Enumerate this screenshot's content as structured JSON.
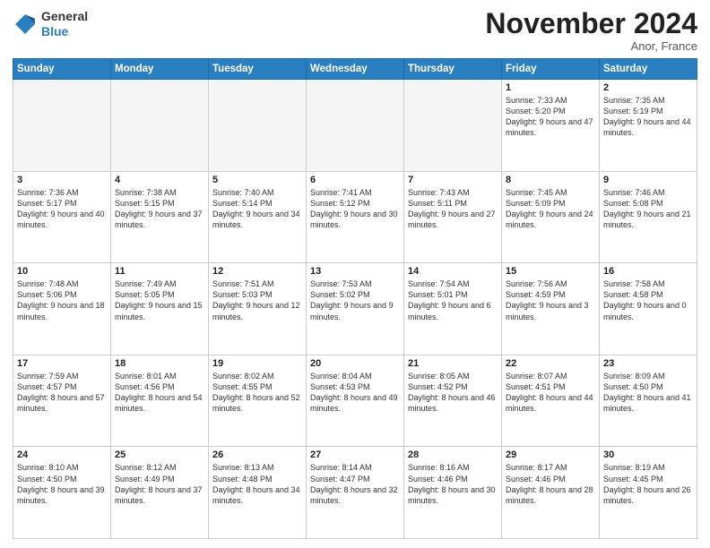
{
  "header": {
    "logo_line1": "General",
    "logo_line2": "Blue",
    "month_title": "November 2024",
    "location": "Anor, France"
  },
  "weekdays": [
    "Sunday",
    "Monday",
    "Tuesday",
    "Wednesday",
    "Thursday",
    "Friday",
    "Saturday"
  ],
  "weeks": [
    [
      {
        "day": "",
        "info": ""
      },
      {
        "day": "",
        "info": ""
      },
      {
        "day": "",
        "info": ""
      },
      {
        "day": "",
        "info": ""
      },
      {
        "day": "",
        "info": ""
      },
      {
        "day": "1",
        "info": "Sunrise: 7:33 AM\nSunset: 5:20 PM\nDaylight: 9 hours and 47 minutes."
      },
      {
        "day": "2",
        "info": "Sunrise: 7:35 AM\nSunset: 5:19 PM\nDaylight: 9 hours and 44 minutes."
      }
    ],
    [
      {
        "day": "3",
        "info": "Sunrise: 7:36 AM\nSunset: 5:17 PM\nDaylight: 9 hours and 40 minutes."
      },
      {
        "day": "4",
        "info": "Sunrise: 7:38 AM\nSunset: 5:15 PM\nDaylight: 9 hours and 37 minutes."
      },
      {
        "day": "5",
        "info": "Sunrise: 7:40 AM\nSunset: 5:14 PM\nDaylight: 9 hours and 34 minutes."
      },
      {
        "day": "6",
        "info": "Sunrise: 7:41 AM\nSunset: 5:12 PM\nDaylight: 9 hours and 30 minutes."
      },
      {
        "day": "7",
        "info": "Sunrise: 7:43 AM\nSunset: 5:11 PM\nDaylight: 9 hours and 27 minutes."
      },
      {
        "day": "8",
        "info": "Sunrise: 7:45 AM\nSunset: 5:09 PM\nDaylight: 9 hours and 24 minutes."
      },
      {
        "day": "9",
        "info": "Sunrise: 7:46 AM\nSunset: 5:08 PM\nDaylight: 9 hours and 21 minutes."
      }
    ],
    [
      {
        "day": "10",
        "info": "Sunrise: 7:48 AM\nSunset: 5:06 PM\nDaylight: 9 hours and 18 minutes."
      },
      {
        "day": "11",
        "info": "Sunrise: 7:49 AM\nSunset: 5:05 PM\nDaylight: 9 hours and 15 minutes."
      },
      {
        "day": "12",
        "info": "Sunrise: 7:51 AM\nSunset: 5:03 PM\nDaylight: 9 hours and 12 minutes."
      },
      {
        "day": "13",
        "info": "Sunrise: 7:53 AM\nSunset: 5:02 PM\nDaylight: 9 hours and 9 minutes."
      },
      {
        "day": "14",
        "info": "Sunrise: 7:54 AM\nSunset: 5:01 PM\nDaylight: 9 hours and 6 minutes."
      },
      {
        "day": "15",
        "info": "Sunrise: 7:56 AM\nSunset: 4:59 PM\nDaylight: 9 hours and 3 minutes."
      },
      {
        "day": "16",
        "info": "Sunrise: 7:58 AM\nSunset: 4:58 PM\nDaylight: 9 hours and 0 minutes."
      }
    ],
    [
      {
        "day": "17",
        "info": "Sunrise: 7:59 AM\nSunset: 4:57 PM\nDaylight: 8 hours and 57 minutes."
      },
      {
        "day": "18",
        "info": "Sunrise: 8:01 AM\nSunset: 4:56 PM\nDaylight: 8 hours and 54 minutes."
      },
      {
        "day": "19",
        "info": "Sunrise: 8:02 AM\nSunset: 4:55 PM\nDaylight: 8 hours and 52 minutes."
      },
      {
        "day": "20",
        "info": "Sunrise: 8:04 AM\nSunset: 4:53 PM\nDaylight: 8 hours and 49 minutes."
      },
      {
        "day": "21",
        "info": "Sunrise: 8:05 AM\nSunset: 4:52 PM\nDaylight: 8 hours and 46 minutes."
      },
      {
        "day": "22",
        "info": "Sunrise: 8:07 AM\nSunset: 4:51 PM\nDaylight: 8 hours and 44 minutes."
      },
      {
        "day": "23",
        "info": "Sunrise: 8:09 AM\nSunset: 4:50 PM\nDaylight: 8 hours and 41 minutes."
      }
    ],
    [
      {
        "day": "24",
        "info": "Sunrise: 8:10 AM\nSunset: 4:50 PM\nDaylight: 8 hours and 39 minutes."
      },
      {
        "day": "25",
        "info": "Sunrise: 8:12 AM\nSunset: 4:49 PM\nDaylight: 8 hours and 37 minutes."
      },
      {
        "day": "26",
        "info": "Sunrise: 8:13 AM\nSunset: 4:48 PM\nDaylight: 8 hours and 34 minutes."
      },
      {
        "day": "27",
        "info": "Sunrise: 8:14 AM\nSunset: 4:47 PM\nDaylight: 8 hours and 32 minutes."
      },
      {
        "day": "28",
        "info": "Sunrise: 8:16 AM\nSunset: 4:46 PM\nDaylight: 8 hours and 30 minutes."
      },
      {
        "day": "29",
        "info": "Sunrise: 8:17 AM\nSunset: 4:46 PM\nDaylight: 8 hours and 28 minutes."
      },
      {
        "day": "30",
        "info": "Sunrise: 8:19 AM\nSunset: 4:45 PM\nDaylight: 8 hours and 26 minutes."
      }
    ]
  ]
}
